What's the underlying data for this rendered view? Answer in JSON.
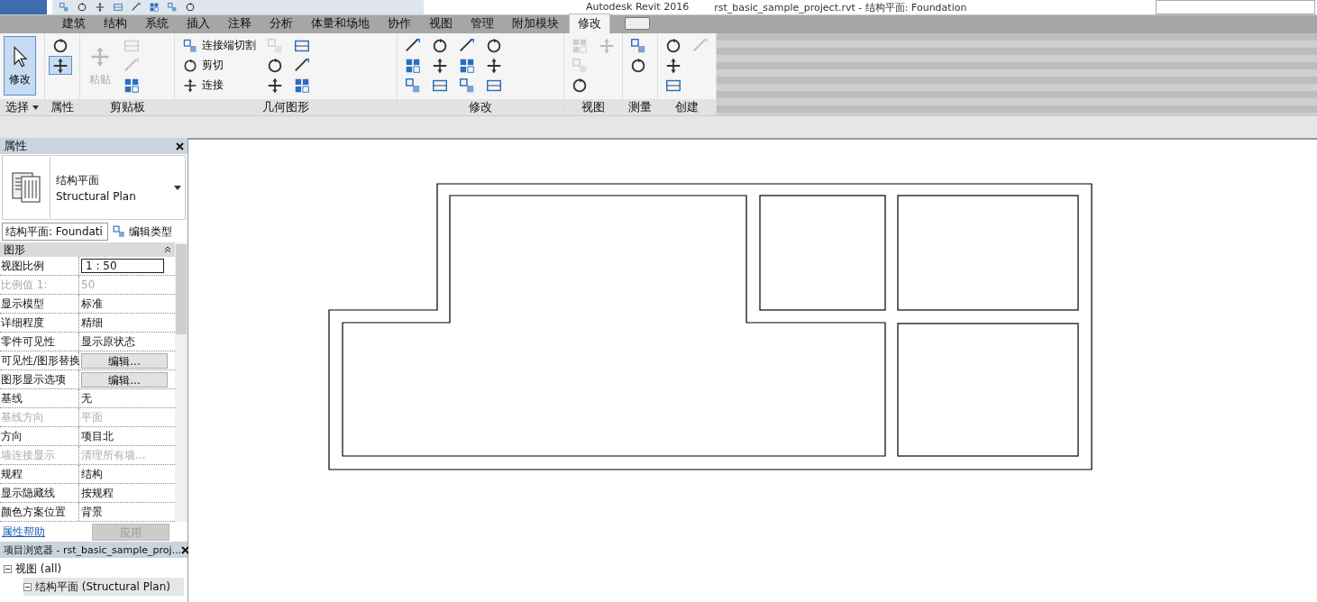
{
  "title_bar": {
    "app": "Autodesk Revit 2016",
    "document": "rst_basic_sample_project.rvt - 结构平面: Foundation"
  },
  "tabs": [
    {
      "label": "建筑",
      "selected": false
    },
    {
      "label": "结构",
      "selected": false
    },
    {
      "label": "系统",
      "selected": false
    },
    {
      "label": "插入",
      "selected": false
    },
    {
      "label": "注释",
      "selected": false
    },
    {
      "label": "分析",
      "selected": false
    },
    {
      "label": "体量和场地",
      "selected": false
    },
    {
      "label": "协作",
      "selected": false
    },
    {
      "label": "视图",
      "selected": false
    },
    {
      "label": "管理",
      "selected": false
    },
    {
      "label": "附加模块",
      "selected": false
    },
    {
      "label": "修改",
      "selected": true
    }
  ],
  "ribbon_panels": [
    {
      "label": "选择",
      "has_menu": true,
      "tools": [
        {
          "kind": "large",
          "label": "修改",
          "selected": true,
          "disabled": false
        }
      ]
    },
    {
      "label": "属性",
      "has_menu": false,
      "tools": [
        {
          "kind": "small",
          "selected": false,
          "disabled": false
        },
        {
          "kind": "small",
          "selected": true,
          "disabled": false
        }
      ]
    },
    {
      "label": "剪贴板",
      "has_menu": false,
      "tools": [
        {
          "kind": "large",
          "label": "粘贴",
          "selected": false,
          "disabled": true
        },
        {
          "kind": "small",
          "selected": false,
          "disabled": true
        },
        {
          "kind": "small",
          "selected": false,
          "disabled": true
        },
        {
          "kind": "small",
          "selected": false,
          "disabled": false
        }
      ]
    },
    {
      "label": "几何图形",
      "has_menu": false,
      "tools": [
        {
          "kind": "row",
          "label": "连接端切割",
          "selected": false,
          "disabled": false
        },
        {
          "kind": "row",
          "label": "剪切",
          "selected": false,
          "disabled": false
        },
        {
          "kind": "row",
          "label": "连接",
          "selected": false,
          "disabled": false
        },
        {
          "kind": "small",
          "selected": false,
          "disabled": true
        },
        {
          "kind": "small",
          "selected": false,
          "disabled": false
        },
        {
          "kind": "small",
          "selected": false,
          "disabled": false
        },
        {
          "kind": "small",
          "selected": false,
          "disabled": false
        },
        {
          "kind": "small",
          "selected": false,
          "disabled": false
        },
        {
          "kind": "small",
          "selected": false,
          "disabled": false
        }
      ]
    },
    {
      "label": "修改",
      "has_menu": false,
      "tools": [
        {
          "kind": "small",
          "selected": false,
          "disabled": false
        },
        {
          "kind": "small",
          "selected": false,
          "disabled": false
        },
        {
          "kind": "small",
          "selected": false,
          "disabled": false
        },
        {
          "kind": "small",
          "selected": false,
          "disabled": false
        },
        {
          "kind": "small",
          "selected": false,
          "disabled": false
        },
        {
          "kind": "small",
          "selected": false,
          "disabled": false
        },
        {
          "kind": "small",
          "selected": false,
          "disabled": false
        },
        {
          "kind": "small",
          "selected": false,
          "disabled": false
        },
        {
          "kind": "small",
          "selected": false,
          "disabled": false
        },
        {
          "kind": "small",
          "selected": false,
          "disabled": false
        },
        {
          "kind": "small",
          "selected": false,
          "disabled": false
        },
        {
          "kind": "small",
          "selected": false,
          "disabled": false
        }
      ]
    },
    {
      "label": "视图",
      "has_menu": false,
      "tools": [
        {
          "kind": "small",
          "selected": false,
          "disabled": true
        },
        {
          "kind": "small",
          "selected": false,
          "disabled": true
        },
        {
          "kind": "small",
          "selected": false,
          "disabled": false
        },
        {
          "kind": "small",
          "selected": false,
          "disabled": true
        }
      ]
    },
    {
      "label": "测量",
      "has_menu": false,
      "tools": [
        {
          "kind": "small",
          "selected": false,
          "disabled": false
        },
        {
          "kind": "small",
          "selected": false,
          "disabled": false
        }
      ]
    },
    {
      "label": "创建",
      "has_menu": false,
      "tools": [
        {
          "kind": "small",
          "selected": false,
          "disabled": false
        },
        {
          "kind": "small",
          "selected": false,
          "disabled": false
        },
        {
          "kind": "small",
          "selected": false,
          "disabled": false
        },
        {
          "kind": "small",
          "selected": false,
          "disabled": true
        }
      ]
    }
  ],
  "properties": {
    "title": "属性",
    "type_name": "结构平面",
    "type_name_en": "Structural Plan",
    "instance": "结构平面: Foundati",
    "edit_type": "编辑类型",
    "group": "图形",
    "rows": [
      {
        "label": "视图比例",
        "value": "1 : 50",
        "kind": "field",
        "disabled": false
      },
      {
        "label": "比例值 1:",
        "value": "50",
        "kind": "text",
        "disabled": true
      },
      {
        "label": "显示模型",
        "value": "标准",
        "kind": "text",
        "disabled": false
      },
      {
        "label": "详细程度",
        "value": "精细",
        "kind": "text",
        "disabled": false
      },
      {
        "label": "零件可见性",
        "value": "显示原状态",
        "kind": "text",
        "disabled": false
      },
      {
        "label": "可见性/图形替换",
        "value": "编辑...",
        "kind": "button",
        "disabled": false
      },
      {
        "label": "图形显示选项",
        "value": "编辑...",
        "kind": "button",
        "disabled": false
      },
      {
        "label": "基线",
        "value": "无",
        "kind": "text",
        "disabled": false
      },
      {
        "label": "基线方向",
        "value": "平面",
        "kind": "text",
        "disabled": true
      },
      {
        "label": "方向",
        "value": "项目北",
        "kind": "text",
        "disabled": false
      },
      {
        "label": "墙连接显示",
        "value": "清理所有墙...",
        "kind": "text",
        "disabled": true
      },
      {
        "label": "规程",
        "value": "结构",
        "kind": "text",
        "disabled": false
      },
      {
        "label": "显示隐藏线",
        "value": "按规程",
        "kind": "text",
        "disabled": false
      },
      {
        "label": "颜色方案位置",
        "value": "背景",
        "kind": "text",
        "disabled": false
      }
    ],
    "help_link": "属性帮助",
    "apply": "应用"
  },
  "project_browser": {
    "title": "项目浏览器 - rst_basic_sample_proj...",
    "tree": [
      {
        "label": "视图 (all)",
        "expanded": true,
        "selected": false,
        "children": [
          {
            "label": "结构平面 (Structural Plan)",
            "expanded": true,
            "selected": true
          }
        ]
      }
    ]
  }
}
